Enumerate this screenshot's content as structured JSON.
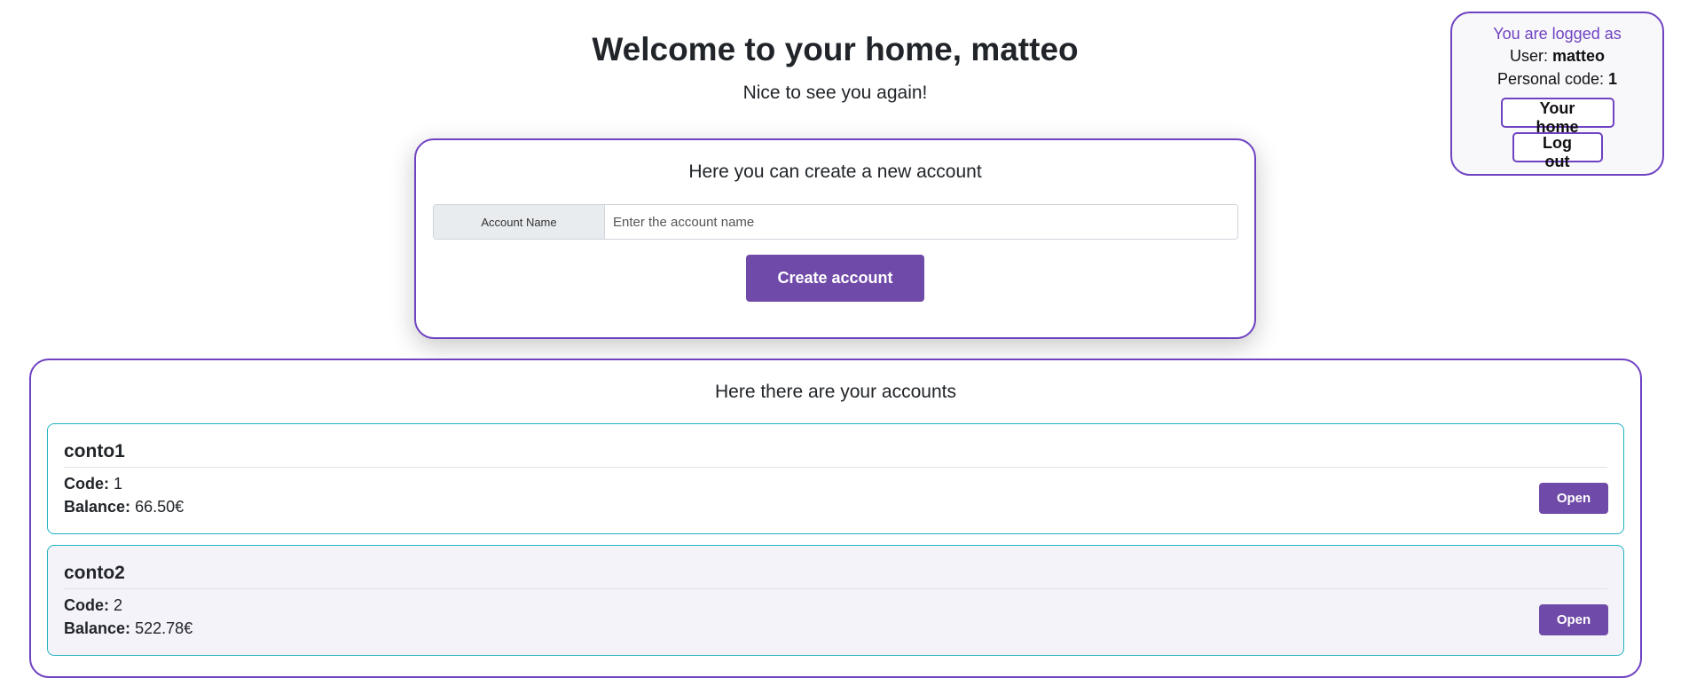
{
  "header": {
    "title": "Welcome to your home, matteo",
    "subtitle": "Nice to see you again!"
  },
  "login_box": {
    "logged_label": "You are logged as",
    "user_label": "User:",
    "user_value": "matteo",
    "code_label": "Personal code:",
    "code_value": "1",
    "home_button": "Your home",
    "logout_button": "Log out"
  },
  "create_account": {
    "title": "Here you can create a new account",
    "input_label": "Account Name",
    "input_placeholder": "Enter the account name",
    "input_value": "",
    "button": "Create account"
  },
  "accounts": {
    "title": "Here there are your accounts",
    "code_label": "Code:",
    "balance_label": "Balance:",
    "open_label": "Open",
    "items": [
      {
        "name": "conto1",
        "code": "1",
        "balance": "66.50€"
      },
      {
        "name": "conto2",
        "code": "2",
        "balance": "522.78€"
      }
    ]
  },
  "colors": {
    "accent": "#6f42c1",
    "button": "#6f4aa8",
    "account_border": "#20b2c0"
  }
}
